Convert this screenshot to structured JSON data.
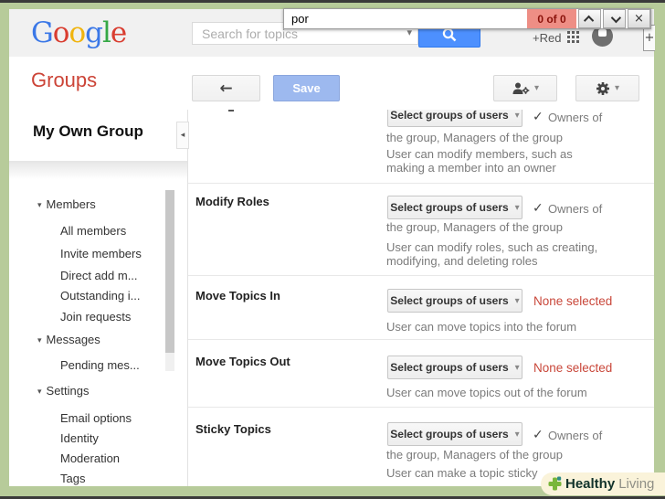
{
  "icons": {
    "check": "✓",
    "dropdown": "▾",
    "section_arrow": "▾",
    "collapse": "◂",
    "back": "←",
    "close": "×",
    "plus_partial": "+"
  },
  "colors": {
    "frame_green": "#b7cb9a",
    "search_button_blue": "#4d90fe",
    "groups_red": "#cc4437",
    "save_blue_bg": "#9db9ef",
    "save_blue_border": "#8aa6dd",
    "none_selected_red": "#c9473a",
    "find_badge_bg": "#ee8e85",
    "find_badge_text": "#8a120b"
  },
  "findbar": {
    "query": "por",
    "count": "0 of 0"
  },
  "header": {
    "logo_letters": [
      {
        "ch": "G",
        "color": "#3b78e7"
      },
      {
        "ch": "o",
        "color": "#d93d30"
      },
      {
        "ch": "o",
        "color": "#f0b40f"
      },
      {
        "ch": "g",
        "color": "#3b78e7"
      },
      {
        "ch": "l",
        "color": "#35a845"
      },
      {
        "ch": "e",
        "color": "#d93d30"
      }
    ],
    "search_placeholder": "Search for topics",
    "account_label": "+Red"
  },
  "toolbar": {
    "title": "Groups",
    "save": "Save"
  },
  "sidebar": {
    "title": "My Own Group",
    "items": [
      {
        "label": "Members",
        "type": "parent"
      },
      {
        "label": "All members",
        "type": "child"
      },
      {
        "label": "Invite members",
        "type": "child"
      },
      {
        "label": "Direct add m...",
        "type": "child"
      },
      {
        "label": "Outstanding i...",
        "type": "child"
      },
      {
        "label": "Join requests",
        "type": "child"
      },
      {
        "label": "Messages",
        "type": "parent"
      },
      {
        "label": "Pending mes...",
        "type": "child"
      },
      {
        "label": "Settings",
        "type": "parent"
      },
      {
        "label": "Email options",
        "type": "child"
      },
      {
        "label": "Identity",
        "type": "child"
      },
      {
        "label": "Moderation",
        "type": "child"
      },
      {
        "label": "Tags",
        "type": "child"
      }
    ]
  },
  "main": {
    "select_button": "Select groups of users",
    "rows": [
      {
        "label": "",
        "status_type": "check",
        "status": "Owners of",
        "status_wrap": "the group, Managers of the group",
        "desc1": "User can modify members, such as",
        "desc2": "making a member into an owner"
      },
      {
        "label": "Modify Roles",
        "status_type": "check",
        "status": "Owners of",
        "status_wrap": "the group, Managers of the group",
        "desc1": "User can modify roles, such as creating,",
        "desc2": "modifying, and deleting roles"
      },
      {
        "label": "Move Topics In",
        "status_type": "none",
        "status": "None selected",
        "desc1": "User can move topics into the forum"
      },
      {
        "label": "Move Topics Out",
        "status_type": "none",
        "status": "None selected",
        "desc1": "User can move topics out of the forum"
      },
      {
        "label": "Sticky Topics",
        "status_type": "check",
        "status": "Owners of",
        "status_wrap": "the group, Managers of the group",
        "desc1": "User can make a topic sticky"
      }
    ]
  },
  "watermark": {
    "bold": "Healthy",
    "regular": "Living"
  }
}
